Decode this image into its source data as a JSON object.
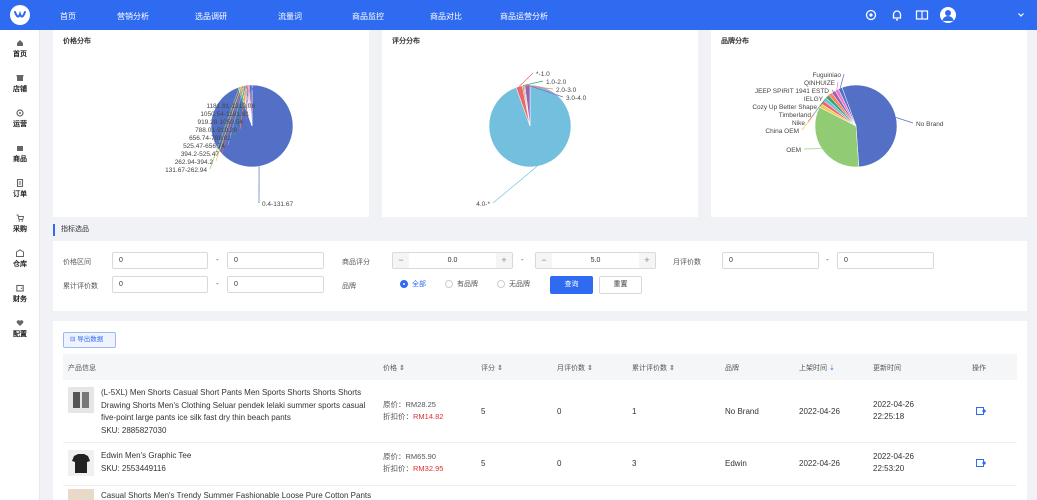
{
  "nav": {
    "items": [
      "首页",
      "营销分析",
      "选品调研",
      "流量词",
      "商品监控",
      "商品对比",
      "商品运营分析"
    ]
  },
  "header_icons": [
    "gear-icon",
    "bell-icon",
    "book-icon",
    "user-avatar-icon",
    "chevron-down-icon"
  ],
  "sidebar": {
    "items": [
      {
        "label": "首页",
        "icon": "home-icon"
      },
      {
        "label": "店铺",
        "icon": "store-icon"
      },
      {
        "label": "运营",
        "icon": "gear-icon"
      },
      {
        "label": "商品",
        "icon": "box-icon"
      },
      {
        "label": "订单",
        "icon": "order-icon"
      },
      {
        "label": "采购",
        "icon": "cart-icon"
      },
      {
        "label": "仓库",
        "icon": "warehouse-icon"
      },
      {
        "label": "财务",
        "icon": "wallet-icon"
      },
      {
        "label": "配置",
        "icon": "heart-icon"
      }
    ]
  },
  "charts": {
    "price_title": "价格分布",
    "rating_title": "评分分布",
    "brand_title": "品牌分布"
  },
  "chart_data": [
    {
      "type": "pie",
      "title": "价格分布",
      "labels": [
        "0.4-131.67",
        "131.67-262.94",
        "262.94-394.2",
        "394.2-525.47",
        "525.47-656.74",
        "656.74-788.01",
        "788.01-919.28",
        "919.28-1050.54",
        "1050.54-1181.81",
        "1181.81-1313.08"
      ],
      "values": [
        94.5,
        1.0,
        0.6,
        0.5,
        0.5,
        0.5,
        0.5,
        0.5,
        0.4,
        1.0
      ],
      "colors": [
        "#5470c6",
        "#91cc75",
        "#fac858",
        "#ee6666",
        "#73c0de",
        "#3ba272",
        "#fc8452",
        "#9a60b4",
        "#ea7ccc",
        "#5470c6"
      ]
    },
    {
      "type": "pie",
      "title": "评分分布",
      "labels": [
        "4.0-*",
        "*-1.0",
        "1.0-2.0",
        "2.0-3.0",
        "3.0-4.0"
      ],
      "values": [
        94.5,
        2.5,
        0.5,
        0.5,
        2.0
      ],
      "colors": [
        "#73c0de",
        "#ee6666",
        "#3ba272",
        "#fc8452",
        "#9a60b4"
      ]
    },
    {
      "type": "pie",
      "title": "品牌分布",
      "labels": [
        "No Brand",
        "OEM",
        "China OEM",
        "Nike",
        "Timberland",
        "Cozy Up Better Shape",
        "IELGY",
        "JEEP SPIRIT 1941 ESTD",
        "QINHUIZE",
        "Fuguiniao"
      ],
      "values": [
        55.0,
        34.0,
        1.5,
        1.5,
        1.5,
        1.5,
        1.5,
        1.5,
        1.5,
        1.5
      ],
      "colors": [
        "#5470c6",
        "#91cc75",
        "#fac858",
        "#ee6666",
        "#73c0de",
        "#3ba272",
        "#fc8452",
        "#9a60b4",
        "#ea7ccc",
        "#5470c6"
      ]
    }
  ],
  "filters": {
    "section_title": "指标选品",
    "price_label": "价格区间",
    "price_min": "0",
    "price_max": "0",
    "rating_label": "商品评分",
    "rating_min": "0.0",
    "rating_max": "5.0",
    "monthly_label": "月评价数",
    "monthly_min": "0",
    "monthly_max": "0",
    "total_label": "累计评价数",
    "total_min": "0",
    "total_max": "0",
    "brand_label": "品牌",
    "brand_options": [
      "全部",
      "有品牌",
      "无品牌"
    ],
    "brand_selected": "全部",
    "search_label": "查询",
    "reset_label": "重置",
    "dash": "-",
    "minus": "−",
    "plus": "+"
  },
  "table": {
    "export_label": "导出数据",
    "headers": [
      "产品信息",
      "价格",
      "评分",
      "月评价数",
      "累计评价数",
      "品牌",
      "上架时间",
      "更新时间",
      "操作"
    ],
    "rows": [
      {
        "name": "(L-5XL) Men Shorts Casual Short Pants Men Sports Shorts Shorts Shorts Drawing Shorts Men's Clothing Seluar pendek lelaki summer sports casual five-point large pants ice silk fast dry thin beach pants",
        "sku": "SKU: 2885827030",
        "original_price_label": "原价：",
        "original_price": "RM28.25",
        "discount_price_label": "折扣价：",
        "discount_price": "RM14.82",
        "rating": "5",
        "monthly": "0",
        "total": "1",
        "brand": "No Brand",
        "listed": "2022-04-26",
        "updated": "2022-04-26 22:25:18"
      },
      {
        "name": "Edwin Men's Graphic Tee",
        "sku": "SKU: 2553449116",
        "original_price_label": "原价：",
        "original_price": "RM65.90",
        "discount_price_label": "折扣价：",
        "discount_price": "RM32.95",
        "rating": "5",
        "monthly": "0",
        "total": "3",
        "brand": "Edwin",
        "listed": "2022-04-26",
        "updated": "2022-04-26 22:53:20"
      },
      {
        "name": "Casual Shorts Men's Trendy Summer Fashionable Loose Pure Cotton Pants"
      }
    ]
  }
}
